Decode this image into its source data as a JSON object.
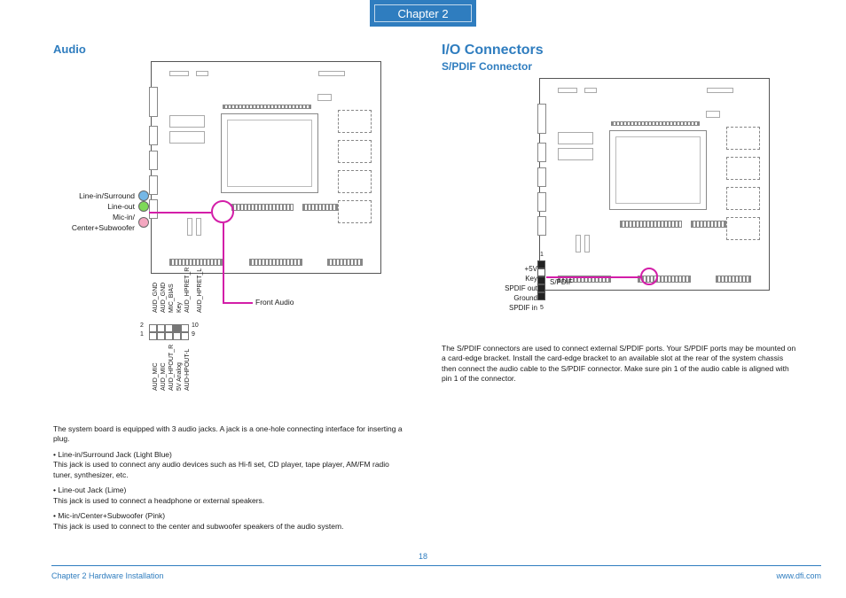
{
  "chapter_tab": "Chapter 2",
  "page_number": "18",
  "footer": {
    "left": "Chapter 2 Hardware Installation",
    "right": "www.dfi.com"
  },
  "left": {
    "heading": "Audio",
    "jacks": {
      "line_in": "Line-in/Surround",
      "line_out": "Line-out",
      "mic_in": "Mic-in/\nCenter+Subwoofer"
    },
    "front_audio_label": "Front Audio",
    "pin_header": {
      "top_row": [
        "AUD_GND",
        "AUD_GND",
        "MIC_BIAS",
        "Key",
        "AUD_HPRET_R",
        "",
        "AUD_HPRET_L"
      ],
      "bottom_row": [
        "AUD_MIC",
        "AUD_MIC",
        "AUD_HPOUT_R",
        "5V Analog",
        "AUD-HPOUT-L"
      ],
      "nums": {
        "tl": "2",
        "bl": "1",
        "tr": "10",
        "br": "9"
      }
    },
    "body": {
      "intro": "The system board is equipped with 3 audio jacks. A jack is a one-hole connecting interface for inserting a plug.",
      "b1_title": "• Line-in/Surround Jack (Light Blue)",
      "b1_text": "This jack is used to connect any audio devices such as Hi-fi set, CD player, tape player, AM/FM radio tuner, synthesizer, etc.",
      "b2_title": "• Line-out Jack (Lime)",
      "b2_text": "This jack is used to connect a headphone or external speakers.",
      "b3_title": "• Mic-in/Center+Subwoofer (Pink)",
      "b3_text": "This jack is used to connect to the center and subwoofer speakers of the audio system."
    }
  },
  "right": {
    "heading1": "I/O Connectors",
    "heading2": "S/PDIF Connector",
    "spdif": {
      "pins": [
        "+5V",
        "Key",
        "SPDIF out",
        "Ground",
        "SPDIF in"
      ],
      "label": "S/PDIF",
      "num_top": "1",
      "num_bot": "5"
    },
    "body": "The S/PDIF connectors are used to connect external S/PDIF ports. Your S/PDIF ports may be mounted on a card-edge bracket. Install the card-edge bracket to an available slot at the rear of the system chassis then connect the audio cable to the S/PDIF connector. Make sure pin 1 of the audio cable is aligned with pin 1 of the connector."
  }
}
